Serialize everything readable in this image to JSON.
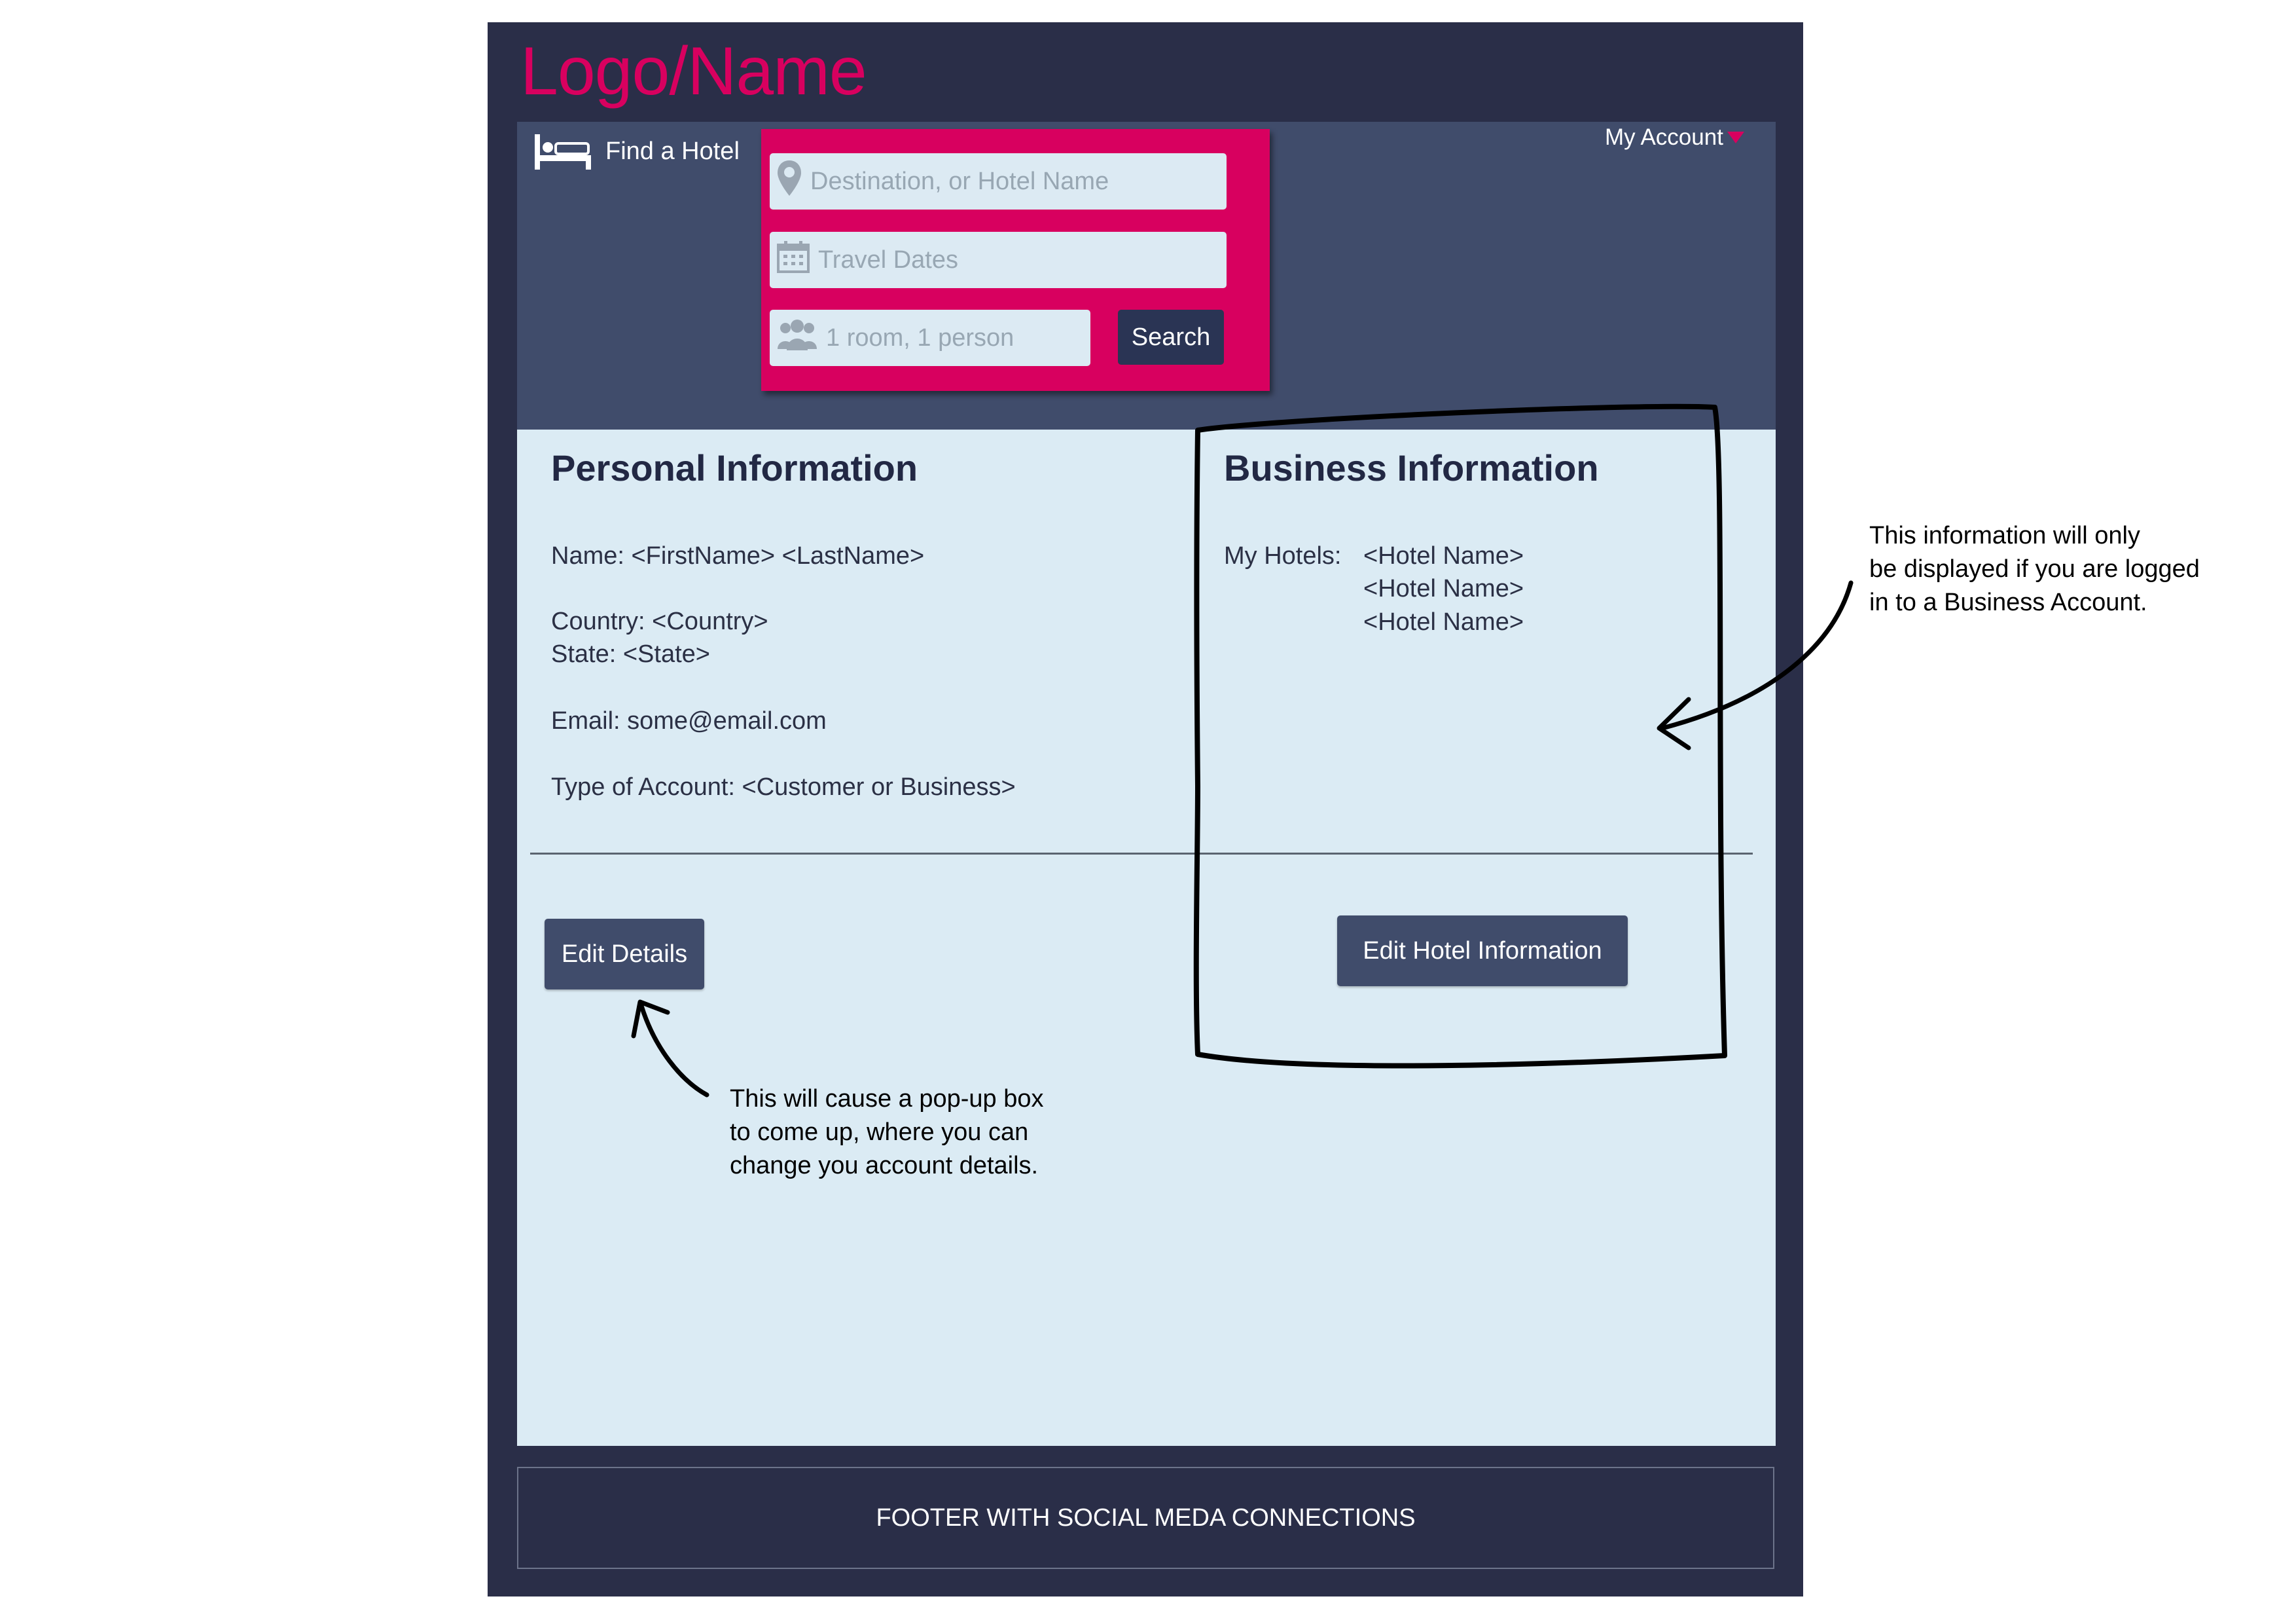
{
  "header": {
    "logo_text": "Logo/Name",
    "find_hotel_label": "Find a Hotel",
    "my_account_label": "My Account"
  },
  "search": {
    "destination_placeholder": "Destination, or Hotel Name",
    "dates_placeholder": "Travel Dates",
    "guests_placeholder": "1 room, 1 person",
    "search_button": "Search"
  },
  "personal": {
    "heading": "Personal Information",
    "name_line": "Name: <FirstName> <LastName>",
    "country_line": "Country: <Country>",
    "state_line": "State: <State>",
    "email_line": "Email: some@email.com",
    "account_type_line": "Type of Account: <Customer or Business>",
    "edit_button": "Edit Details"
  },
  "business": {
    "heading": "Business Information",
    "my_hotels_label": "My Hotels:",
    "hotels": [
      "<Hotel Name>",
      "<Hotel Name>",
      "<Hotel Name>"
    ],
    "edit_button": "Edit Hotel Information"
  },
  "footer": {
    "text": "FOOTER WITH SOCIAL MEDA CONNECTIONS"
  },
  "annotations": {
    "business_note": [
      "This information will only",
      "be displayed if you are logged",
      "in to a Business Account."
    ],
    "edit_note": [
      "This will cause a pop-up box",
      "to come up, where you can",
      "change you account details."
    ]
  },
  "colors": {
    "frame": "#2a2e48",
    "header": "#404c6b",
    "accent": "#d8005f",
    "content": "#dbebf4"
  },
  "icons": {
    "bed": "bed-icon",
    "location": "location-pin-icon",
    "calendar": "calendar-icon",
    "people": "people-icon",
    "dropdown": "caret-down-icon"
  }
}
